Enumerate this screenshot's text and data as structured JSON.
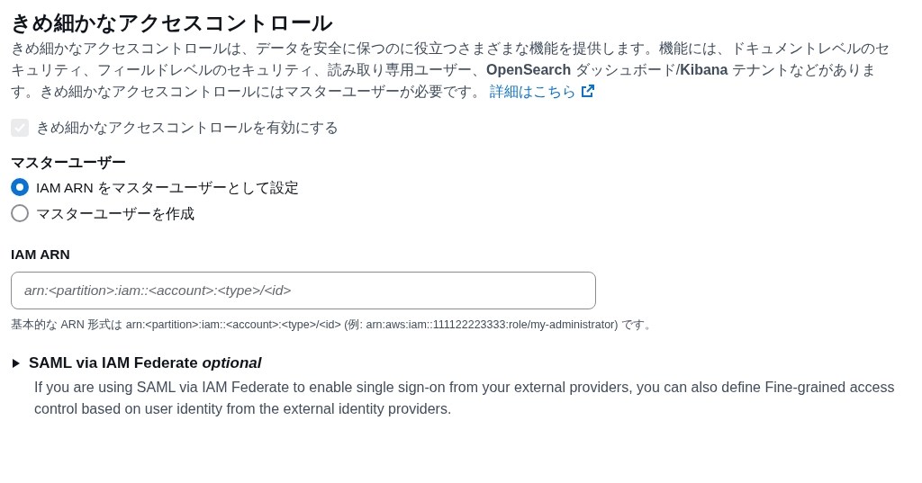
{
  "section": {
    "title": "きめ細かなアクセスコントロール",
    "description": "きめ細かなアクセスコントロールは、データを安全に保つのに役立つさまざまな機能を提供します。機能には、ドキュメントレベルのセキュリティ、フィールドレベルのセキュリティ、読み取り専用ユーザー、**OpenSearch** ダッシュボード/**Kibana** テナントなどがあります。きめ細かなアクセスコントロールにはマスターユーザーが必要です。",
    "link": "詳細はこちら"
  },
  "enable_checkbox": {
    "label": "きめ細かなアクセスコントロールを有効にする",
    "checked": true,
    "disabled": true
  },
  "master_user": {
    "label": "マスターユーザー",
    "options": [
      {
        "label": "IAM ARN をマスターユーザーとして設定",
        "selected": true
      },
      {
        "label": "マスターユーザーを作成",
        "selected": false
      }
    ]
  },
  "iam_arn": {
    "label": "IAM ARN",
    "placeholder": "arn:<partition>:iam::<account>:<type>/<id>",
    "hint": "基本的な ARN 形式は arn:<partition>:iam::<account>:<type>/<id> (例: arn:aws:iam::111122223333:role/my-administrator) です。"
  },
  "saml": {
    "title": "SAML via IAM Federate *optional*",
    "expanded": false,
    "description": "If you are using SAML via IAM Federate to enable single sign-on from your external providers, you can also define Fine-grained access control based on user identity from the external identity providers."
  }
}
